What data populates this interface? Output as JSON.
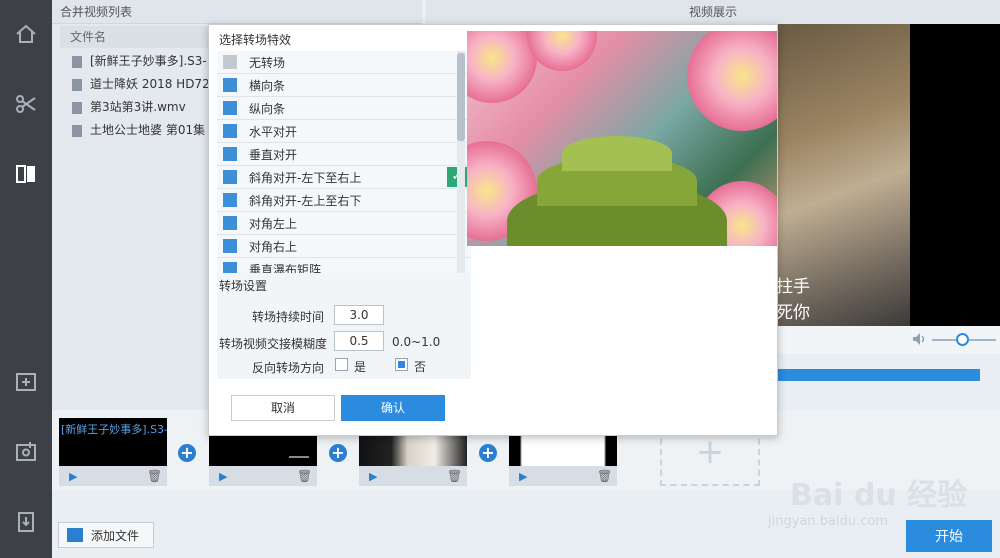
{
  "left_panel": {
    "title": "合并视频列表",
    "column_header": "文件名",
    "files": [
      "[新鲜王子妙事多].S3-16",
      "道士降妖 2018 HD720p",
      "第3站第3讲.wmv",
      "土地公士地婆 第01集 超"
    ]
  },
  "right_panel": {
    "title": "视频展示",
    "subtitle_line1": "拄手",
    "subtitle_line2": "死你"
  },
  "clips": [
    {
      "label": "[新鲜王子妙事多].S3-16"
    },
    {
      "label": ""
    },
    {
      "label": ""
    },
    {
      "label": ""
    }
  ],
  "toolbar": {
    "add_file_label": "添加文件",
    "start_label": "开始"
  },
  "dialog": {
    "title": "选择转场特效",
    "effects": [
      {
        "label": "无转场",
        "selected": false
      },
      {
        "label": "横向条",
        "selected": false
      },
      {
        "label": "纵向条",
        "selected": false
      },
      {
        "label": "水平对开",
        "selected": false
      },
      {
        "label": "垂直对开",
        "selected": false
      },
      {
        "label": "斜角对开-左下至右上",
        "selected": true
      },
      {
        "label": "斜角对开-左上至右下",
        "selected": false
      },
      {
        "label": "对角左上",
        "selected": false
      },
      {
        "label": "对角右上",
        "selected": false
      },
      {
        "label": "垂直瀑布矩阵",
        "selected": false
      }
    ],
    "settings_title": "转场设置",
    "duration_label": "转场持续时间",
    "duration_value": "3.0",
    "blur_label": "转场视频交接模糊度",
    "blur_value": "0.5",
    "blur_range": "0.0~1.0",
    "reverse_label": "反向转场方向",
    "reverse_yes": "是",
    "reverse_no": "否",
    "cancel_label": "取消",
    "ok_label": "确认"
  },
  "watermark": {
    "brand": "Bai du 经验",
    "url": "jingyan.baidu.com"
  },
  "colors": {
    "accent": "#2b8bde",
    "sidebar": "#3d4147",
    "check": "#2aa876"
  }
}
